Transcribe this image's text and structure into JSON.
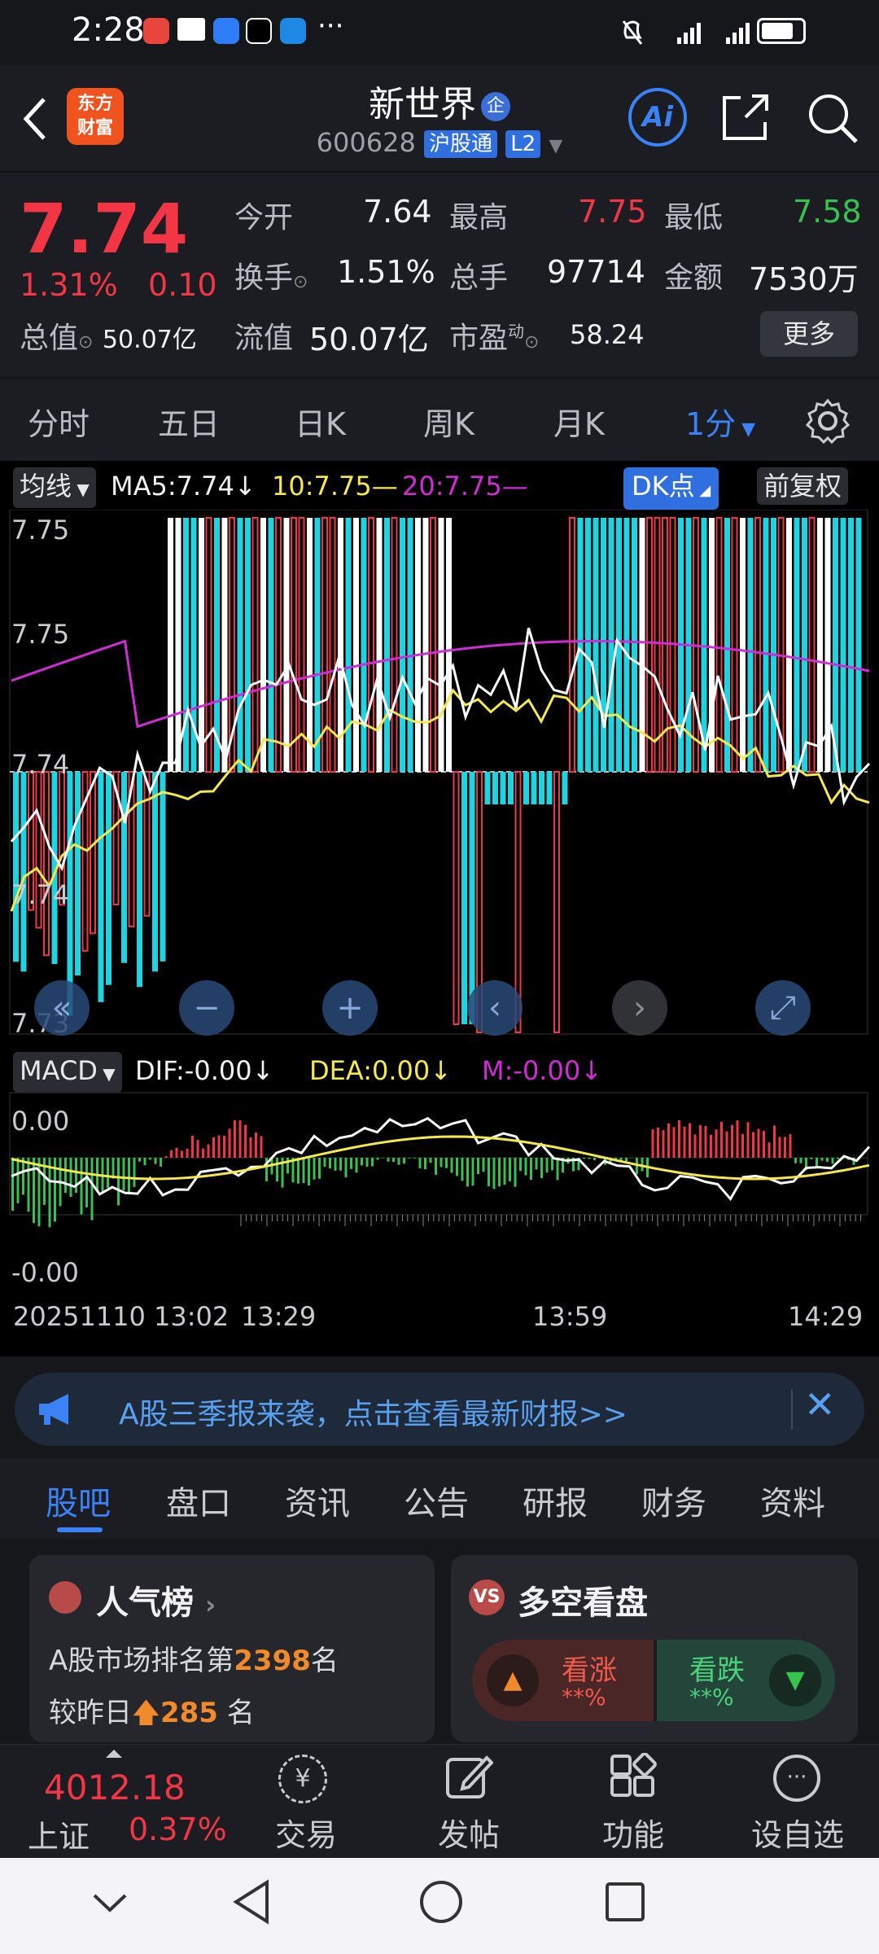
{
  "status_bar": {
    "time": "2:28",
    "more": "···"
  },
  "header": {
    "logo_line1": "东方",
    "logo_line2": "财富",
    "stock_name": "新世界",
    "badge": "企",
    "code": "600628",
    "connect_tag": "沪股通",
    "level_tag": "L2",
    "ai_label": "Ai"
  },
  "quote": {
    "price": "7.74",
    "pct": "1.31%",
    "change": "0.10",
    "open_label": "今开",
    "open": "7.64",
    "high_label": "最高",
    "high": "7.75",
    "low_label": "最低",
    "low": "7.58",
    "turnover_label": "换手",
    "turnover": "1.51%",
    "volume_label": "总手",
    "volume": "97714",
    "amount_label": "金额",
    "amount": "7530万",
    "mcap_label": "总值",
    "mcap": "50.07亿",
    "float_label": "流值",
    "float_cap": "50.07亿",
    "pe_label": "市盈",
    "pe_sup": "动",
    "pe": "58.24",
    "more_btn": "更多"
  },
  "ktabs": [
    "分时",
    "五日",
    "日K",
    "周K",
    "月K",
    "1分"
  ],
  "chart": {
    "ma_selector": "均线",
    "ma5": "MA5:7.74↓",
    "ma10": "10:7.75—",
    "ma20": "20:7.75—",
    "dk_btn": "DK点",
    "adjust_btn": "前复权",
    "y_labels": [
      "7.75",
      "7.75",
      "7.74",
      "7.74",
      "7.73"
    ],
    "macd_selector": "MACD",
    "dif": "DIF:-0.00↓",
    "dea": "DEA:0.00↓",
    "m": "M:-0.00↓",
    "macd_top": "0.00",
    "macd_bottom": "-0.00",
    "x_labels": [
      "20251110 13:02",
      "13:29",
      "13:59",
      "14:29"
    ],
    "colors": {
      "up": "#f23645",
      "down_bar": "#1fd3e0",
      "ma5": "#ffffff",
      "ma10": "#f5e94a",
      "ma20": "#d12bd6",
      "macd_neg": "#35c24f"
    }
  },
  "banner": {
    "text": "A股三季报来袭，点击查看最新财报>>"
  },
  "btabs": [
    "股吧",
    "盘口",
    "资讯",
    "公告",
    "研报",
    "财务",
    "资料"
  ],
  "card_left": {
    "title": "人气榜",
    "line1_prefix": "A股市场排名第",
    "rank": "2398",
    "line1_suffix": "名",
    "line2_prefix": "较昨日",
    "rank_change": "285",
    "line2_suffix": "名"
  },
  "card_right": {
    "title": "多空看盘",
    "bull_label": "看涨",
    "bull_pct": "**%",
    "bear_label": "看跌",
    "bear_pct": "**%"
  },
  "nav": {
    "index_value": "4012.18",
    "index_name": "上证",
    "index_pct": "0.37%",
    "items": [
      "交易",
      "发帖",
      "功能",
      "设自选"
    ]
  }
}
